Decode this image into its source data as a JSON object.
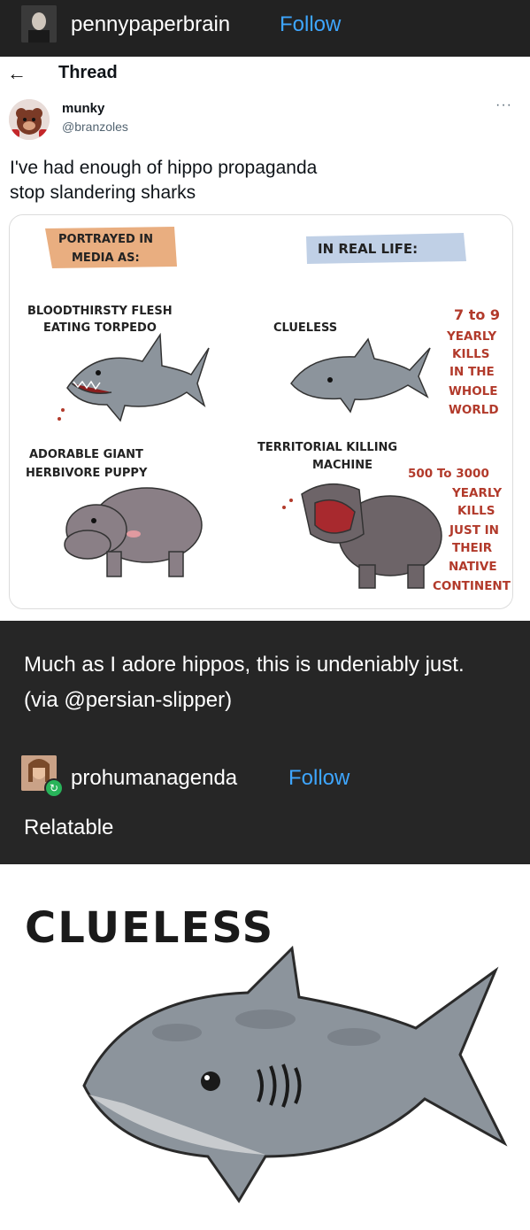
{
  "header": {
    "username": "pennypaperbrain",
    "follow_label": "Follow"
  },
  "thread": {
    "back_icon": "back-arrow-icon",
    "title": "Thread",
    "author_name": "munky",
    "author_handle": "@branzoles",
    "more_icon": "more-icon",
    "text_line1": "I've had enough of hippo propaganda",
    "text_line2": "stop slandering sharks"
  },
  "comic": {
    "header_left": [
      "PORTRAYED IN",
      "MEDIA AS:"
    ],
    "header_right": "IN REAL LIFE:",
    "shark_media": [
      "BLOODTHIRSTY FLESH",
      "EATING TORPEDO"
    ],
    "shark_real": "CLUELESS",
    "shark_stat": [
      "7 to 9",
      "YEARLY",
      "KILLS",
      "IN THE",
      "WHOLE",
      "WORLD"
    ],
    "hippo_media": [
      "ADORABLE GIANT",
      "HERBIVORE PUPPY"
    ],
    "hippo_real": [
      "TERRITORIAL KILLING",
      "MACHINE"
    ],
    "hippo_stat": [
      "500 To 3000",
      "YEARLY",
      "KILLS",
      "JUST IN",
      "THEIR",
      "NATIVE",
      "CONTINENT"
    ]
  },
  "caption": {
    "text": "Much as I adore hippos, this is undeniably just. (via @persian-slipper)"
  },
  "reblog": {
    "username": "prohumanagenda",
    "follow_label": "Follow",
    "badge_icon": "reblog-icon",
    "comment": "Relatable"
  },
  "meme": {
    "label": "CLUELESS"
  },
  "colors": {
    "accent": "#3ea6ff",
    "dark_bg": "#222222",
    "stat_red": "#b23a2b",
    "shark_gray": "#8c949c"
  }
}
